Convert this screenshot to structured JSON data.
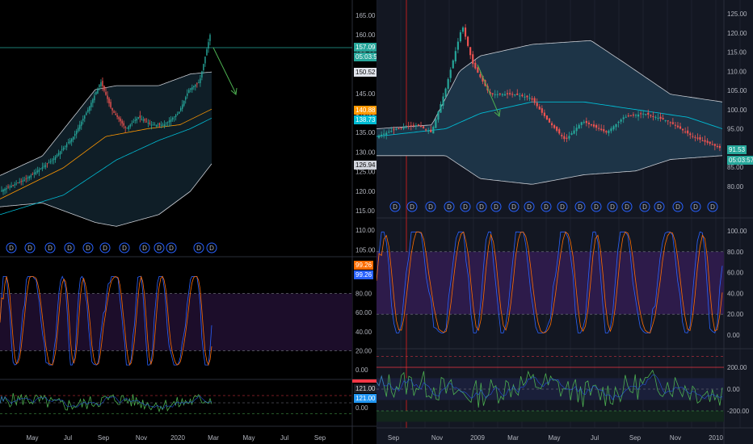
{
  "left": {
    "price_ticks": [
      "165.00",
      "160.00",
      "155.00",
      "150.00",
      "145.00",
      "140.00",
      "135.00",
      "130.00",
      "125.00",
      "120.00",
      "115.00",
      "110.00",
      "105.00"
    ],
    "osc_ticks": [
      "80.00",
      "60.00",
      "40.00",
      "20.00",
      "0.00"
    ],
    "cci_ticks": [
      "0.00"
    ],
    "time_labels": [
      "May",
      "Jul",
      "Sep",
      "Nov",
      "2020",
      "Mar",
      "May",
      "Jul",
      "Sep"
    ],
    "tags": {
      "price_last": "157.09",
      "countdown": "05:03:57",
      "upper_band": "150.52",
      "ma_orange": "140.88",
      "ma_cyan": "138.73",
      "lower_band": "126.94",
      "stoch_k": "99.26",
      "stoch_d": "99.26",
      "cci": "121.00",
      "cci2": "121.00"
    },
    "event_marker": "D",
    "colors": {
      "up": "#26a69a",
      "down": "#ef5350",
      "orange": "#ff9800",
      "cyan": "#00bcd4",
      "band": "#c9cdd4",
      "purple": "#4a148c"
    }
  },
  "right": {
    "price_ticks": [
      "125.00",
      "120.00",
      "115.00",
      "110.00",
      "105.00",
      "100.00",
      "95.00",
      "90.00",
      "85.00",
      "80.00"
    ],
    "osc_ticks": [
      "100.00",
      "80.00",
      "60.00",
      "40.00",
      "20.00",
      "0.00"
    ],
    "cci_ticks": [
      "200.00",
      "0.00",
      "-200.00"
    ],
    "time_labels": [
      "Sep",
      "Nov",
      "2009",
      "Mar",
      "May",
      "Jul",
      "Sep",
      "Nov",
      "2010"
    ],
    "tags": {
      "price_last": "91.53",
      "countdown": "05:03:57"
    },
    "event_marker": "D"
  }
}
